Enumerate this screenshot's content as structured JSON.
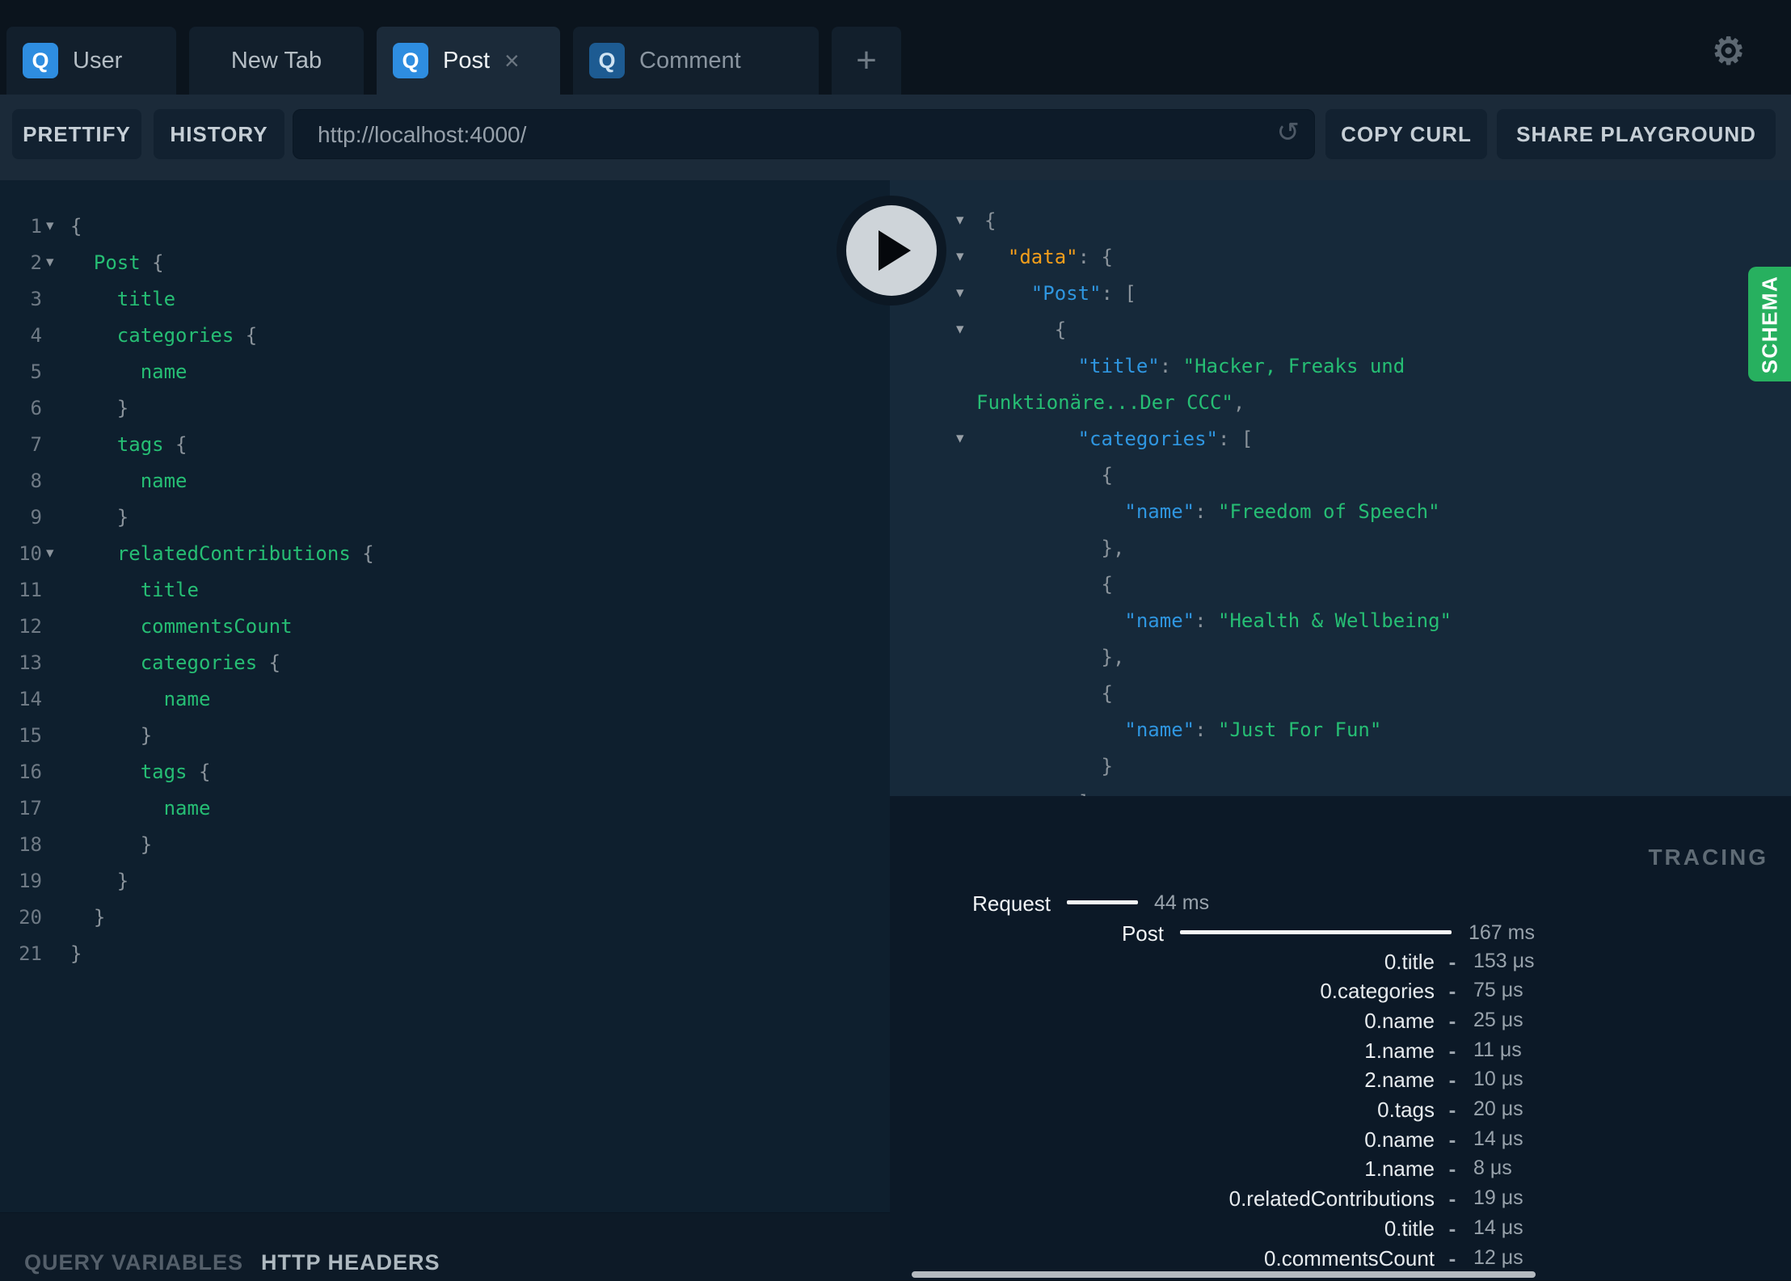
{
  "icons": {
    "fold": "▾",
    "close": "×",
    "plus": "+",
    "reload": "↺",
    "gear": "⚙",
    "query_badge": "Q"
  },
  "colors": {
    "accent_blue": "#2e8de0",
    "schema_green": "#27b05f",
    "key_orange": "#f39e1b",
    "key_blue": "#2f96e0",
    "string_green": "#26be74",
    "editor_bg": "#0e1f2e",
    "response_bg": "#16293a",
    "tracing_bg": "#0c1927"
  },
  "tabbar": {
    "tabs": [
      {
        "label": "User",
        "badge": "Q"
      },
      {
        "label": "New Tab"
      },
      {
        "label": "Post",
        "badge": "Q",
        "close": "×"
      },
      {
        "label": "Comment",
        "badge": "Q"
      }
    ]
  },
  "toolbar": {
    "prettify": "PRETTIFY",
    "history": "HISTORY",
    "url": "http://localhost:4000/",
    "copy_curl": "COPY CURL",
    "share_playground": "SHARE PLAYGROUND"
  },
  "query": {
    "lines": [
      {
        "n": "1",
        "punct": "{",
        "fold": true
      },
      {
        "n": "2",
        "code": "  Post",
        "punct": " {",
        "fold": true
      },
      {
        "n": "3",
        "code": "    title"
      },
      {
        "n": "4",
        "code": "    categories",
        "punct": " {"
      },
      {
        "n": "5",
        "code": "      name"
      },
      {
        "n": "6",
        "punct": "    }"
      },
      {
        "n": "7",
        "code": "    tags",
        "punct": " {"
      },
      {
        "n": "8",
        "code": "      name"
      },
      {
        "n": "9",
        "punct": "    }"
      },
      {
        "n": "10",
        "code": "    relatedContributions",
        "punct": " {",
        "fold": true
      },
      {
        "n": "11",
        "code": "      title"
      },
      {
        "n": "12",
        "code": "      commentsCount"
      },
      {
        "n": "13",
        "code": "      categories",
        "punct": " {"
      },
      {
        "n": "14",
        "code": "        name"
      },
      {
        "n": "15",
        "punct": "      }"
      },
      {
        "n": "16",
        "code": "      tags",
        "punct": " {"
      },
      {
        "n": "17",
        "code": "        name"
      },
      {
        "n": "18",
        "punct": "      }"
      },
      {
        "n": "19",
        "punct": "    }"
      },
      {
        "n": "20",
        "punct": "  }"
      },
      {
        "n": "21",
        "punct": "}"
      }
    ]
  },
  "response": {
    "lines": [
      {
        "tail": "{",
        "arrow": true
      },
      {
        "sp": "  ",
        "key": "\"data\"",
        "sep": ": ",
        "tail": "{",
        "arrow": true,
        "orange": true
      },
      {
        "sp": "    ",
        "key": "\"Post\"",
        "sep": ": ",
        "tail": "[",
        "arrow": true
      },
      {
        "sp": "      ",
        "tail": "{",
        "arrow": true
      },
      {
        "sp": "        ",
        "key": "\"title\"",
        "sep": ": ",
        "val": "\"Hacker, Freaks und"
      },
      {
        "val": "Funktionäre...Der CCC\"",
        "tail": ","
      },
      {
        "sp": "        ",
        "key": "\"categories\"",
        "sep": ": ",
        "tail": "[",
        "arrow": true
      },
      {
        "sp": "          ",
        "tail": "{"
      },
      {
        "sp": "            ",
        "key": "\"name\"",
        "sep": ": ",
        "val": "\"Freedom of Speech\""
      },
      {
        "sp": "          ",
        "tail": "},"
      },
      {
        "sp": "          ",
        "tail": "{"
      },
      {
        "sp": "            ",
        "key": "\"name\"",
        "sep": ": ",
        "val": "\"Health & Wellbeing\""
      },
      {
        "sp": "          ",
        "tail": "},"
      },
      {
        "sp": "          ",
        "tail": "{"
      },
      {
        "sp": "            ",
        "key": "\"name\"",
        "sep": ": ",
        "val": "\"Just For Fun\""
      },
      {
        "sp": "          ",
        "tail": "}"
      },
      {
        "sp": "        ",
        "tail": "]"
      }
    ]
  },
  "schema_tab": "SCHEMA",
  "variables": {
    "query_variables": "QUERY VARIABLES",
    "http_headers": "HTTP HEADERS"
  },
  "tracing": {
    "title": "TRACING",
    "request": {
      "label": "Request",
      "time": "44 ms"
    },
    "root": {
      "label": "Post",
      "time": "167 ms"
    },
    "dash": "-",
    "rows": [
      {
        "label": "0.title",
        "value": "153 μs"
      },
      {
        "label": "0.categories",
        "value": "75 μs"
      },
      {
        "label": "0.name",
        "value": "25 μs"
      },
      {
        "label": "1.name",
        "value": "11 μs"
      },
      {
        "label": "2.name",
        "value": "10 μs"
      },
      {
        "label": "0.tags",
        "value": "20 μs"
      },
      {
        "label": "0.name",
        "value": "14 μs"
      },
      {
        "label": "1.name",
        "value": "8 μs"
      },
      {
        "label": "0.relatedContributions",
        "value": "19 μs"
      },
      {
        "label": "0.title",
        "value": "14 μs"
      },
      {
        "label": "0.commentsCount",
        "value": "12 μs"
      }
    ]
  }
}
